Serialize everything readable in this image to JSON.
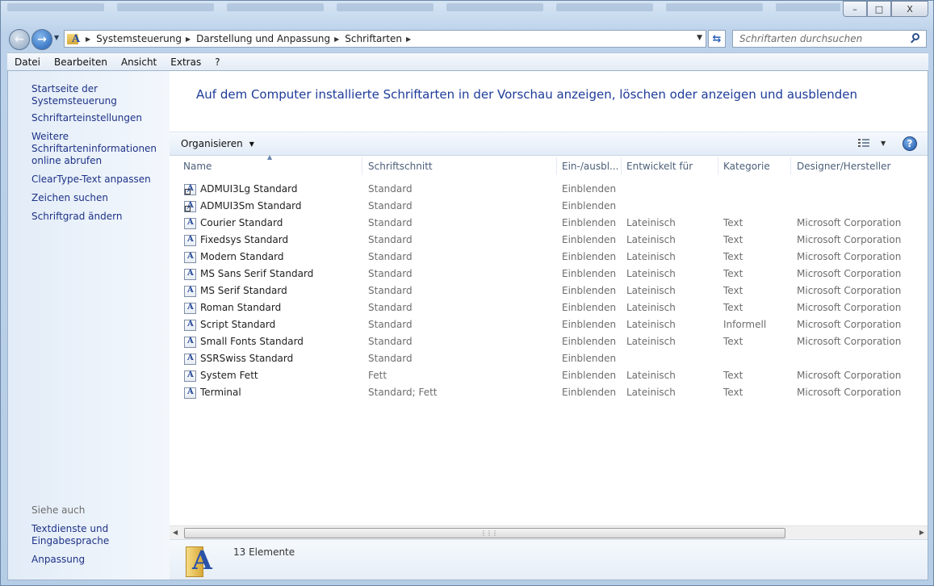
{
  "titlebar": {
    "minimize_label": "–",
    "maximize_label": "□",
    "close_label": "X"
  },
  "navigation": {
    "breadcrumbs": [
      "Systemsteuerung",
      "Darstellung und Anpassung",
      "Schriftarten"
    ],
    "search_placeholder": "Schriftarten durchsuchen"
  },
  "menubar": {
    "items": [
      "Datei",
      "Bearbeiten",
      "Ansicht",
      "Extras",
      "?"
    ]
  },
  "sidebar": {
    "home_link": "Startseite der Systemsteuerung",
    "tasks": [
      "Schriftarteinstellungen",
      "Weitere Schriftarteninformationen online abrufen",
      "ClearType-Text anpassen",
      "Zeichen suchen",
      "Schriftgrad ändern"
    ],
    "see_also_heading": "Siehe auch",
    "see_also": [
      "Textdienste und Eingabesprache",
      "Anpassung"
    ]
  },
  "main": {
    "title": "Auf dem Computer installierte Schriftarten in der Vorschau anzeigen, löschen oder anzeigen und ausblenden",
    "organize_label": "Organisieren",
    "help_label": "?",
    "columns": [
      "Name",
      "Schriftschnitt",
      "Ein-/ausbl...",
      "Entwickelt für",
      "Kategorie",
      "Designer/Hersteller"
    ],
    "rows": [
      {
        "name": "ADMUI3Lg Standard",
        "style": "Standard",
        "visibility": "Einblenden",
        "designed_for": "",
        "category": "",
        "designer": "",
        "icon": "font-shortcut-icon"
      },
      {
        "name": "ADMUI3Sm Standard",
        "style": "Standard",
        "visibility": "Einblenden",
        "designed_for": "",
        "category": "",
        "designer": "",
        "icon": "font-shortcut-icon"
      },
      {
        "name": "Courier Standard",
        "style": "Standard",
        "visibility": "Einblenden",
        "designed_for": "Lateinisch",
        "category": "Text",
        "designer": "Microsoft Corporation",
        "icon": "font-file-icon"
      },
      {
        "name": "Fixedsys Standard",
        "style": "Standard",
        "visibility": "Einblenden",
        "designed_for": "Lateinisch",
        "category": "Text",
        "designer": "Microsoft Corporation",
        "icon": "font-file-icon"
      },
      {
        "name": "Modern Standard",
        "style": "Standard",
        "visibility": "Einblenden",
        "designed_for": "Lateinisch",
        "category": "Text",
        "designer": "Microsoft Corporation",
        "icon": "font-file-icon"
      },
      {
        "name": "MS Sans Serif Standard",
        "style": "Standard",
        "visibility": "Einblenden",
        "designed_for": "Lateinisch",
        "category": "Text",
        "designer": "Microsoft Corporation",
        "icon": "font-file-icon"
      },
      {
        "name": "MS Serif Standard",
        "style": "Standard",
        "visibility": "Einblenden",
        "designed_for": "Lateinisch",
        "category": "Text",
        "designer": "Microsoft Corporation",
        "icon": "font-file-icon"
      },
      {
        "name": "Roman Standard",
        "style": "Standard",
        "visibility": "Einblenden",
        "designed_for": "Lateinisch",
        "category": "Text",
        "designer": "Microsoft Corporation",
        "icon": "font-file-icon"
      },
      {
        "name": "Script Standard",
        "style": "Standard",
        "visibility": "Einblenden",
        "designed_for": "Lateinisch",
        "category": "Informell",
        "designer": "Microsoft Corporation",
        "icon": "font-file-icon"
      },
      {
        "name": "Small Fonts Standard",
        "style": "Standard",
        "visibility": "Einblenden",
        "designed_for": "Lateinisch",
        "category": "Text",
        "designer": "Microsoft Corporation",
        "icon": "font-file-icon"
      },
      {
        "name": "SSRSwiss Standard",
        "style": "Standard",
        "visibility": "Einblenden",
        "designed_for": "",
        "category": "",
        "designer": "",
        "icon": "font-file-icon"
      },
      {
        "name": "System Fett",
        "style": "Fett",
        "visibility": "Einblenden",
        "designed_for": "Lateinisch",
        "category": "Text",
        "designer": "Microsoft Corporation",
        "icon": "font-file-icon"
      },
      {
        "name": "Terminal",
        "style": "Standard; Fett",
        "visibility": "Einblenden",
        "designed_for": "Lateinisch",
        "category": "Text",
        "designer": "Microsoft Corporation",
        "icon": "font-family-icon"
      }
    ]
  },
  "details": {
    "item_count": "13 Elemente"
  },
  "colors": {
    "link": "#1e3287",
    "title": "#1e3b99",
    "secondary_text": "#6d6d6d"
  }
}
